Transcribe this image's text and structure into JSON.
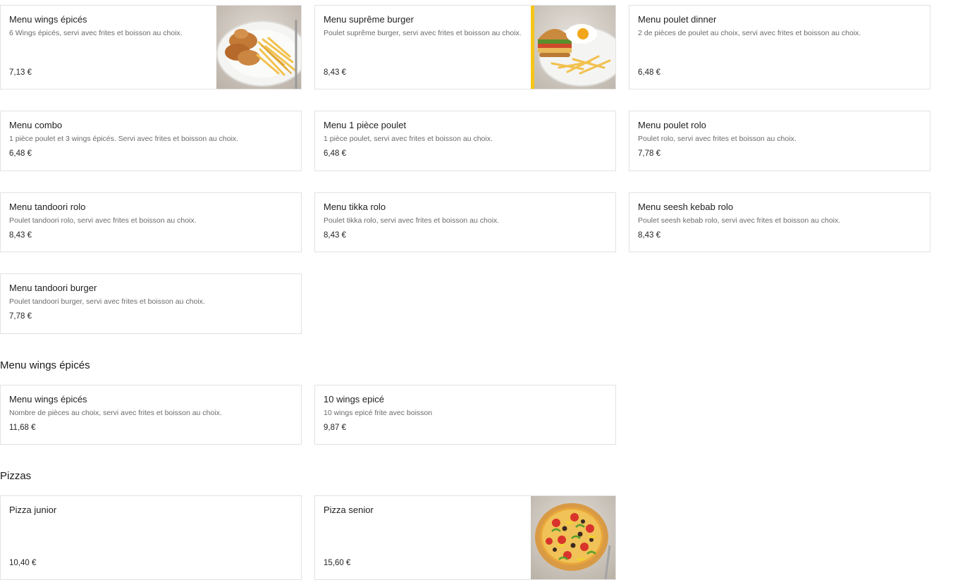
{
  "items": [
    {
      "title": "Menu wings épicés",
      "desc": "6 Wings épicés, servi avec frites et boisson au choix.",
      "price": "7,13 €",
      "image": "spicy-wings-fries-photo"
    },
    {
      "title": "Menu suprême burger",
      "desc": "Poulet suprême burger, servi avec frites et boisson au choix.",
      "price": "8,43 €",
      "image": "burger-fries-egg-photo"
    },
    {
      "title": "Menu poulet dinner",
      "desc": "2 de pièces de poulet au choix, servi avec frites et boisson au choix.",
      "price": "6,48 €"
    },
    {
      "title": "Menu combo",
      "desc": "1 pièce poulet et 3 wings épicés. Servi avec frites et boisson au choix.",
      "price": "6,48 €"
    },
    {
      "title": "Menu 1 pièce poulet",
      "desc": "1 pièce poulet, servi avec frites et boisson au choix.",
      "price": "6,48 €"
    },
    {
      "title": "Menu poulet rolo",
      "desc": "Poulet rolo, servi avec frites et boisson au choix.",
      "price": "7,78 €"
    },
    {
      "title": "Menu tandoori rolo",
      "desc": "Poulet tandoori rolo, servi avec frites et boisson au choix.",
      "price": "8,43 €"
    },
    {
      "title": "Menu tikka rolo",
      "desc": "Poulet tikka rolo, servi avec frites et boisson au choix.",
      "price": "8,43 €"
    },
    {
      "title": "Menu seesh kebab rolo",
      "desc": "Poulet seesh kebab rolo, servi avec frites et boisson au choix.",
      "price": "8,43 €"
    },
    {
      "title": "Menu tandoori burger",
      "desc": "Poulet tandoori burger, servi avec frites et boisson au choix.",
      "price": "7,78 €"
    }
  ],
  "section_wings": {
    "title": "Menu wings épicés",
    "items": [
      {
        "title": "Menu wings épicés",
        "desc": "Nombre de pièces au choix, servi avec frites et boisson au choix.",
        "price": "11,68 €"
      },
      {
        "title": "10 wings epicé",
        "desc": "10 wings epicé frite avec boisson",
        "price": "9,87 €"
      }
    ]
  },
  "section_pizzas": {
    "title": "Pizzas",
    "items": [
      {
        "title": "Pizza junior",
        "price": "10,40 €"
      },
      {
        "title": "Pizza senior",
        "price": "15,60 €",
        "image": "pizza-photo"
      }
    ]
  },
  "colors": {
    "card_border": "#e2e2e2",
    "title_text": "#1f1f1f",
    "desc_text": "#6b6b6b",
    "accent_yellow": "#f5c518"
  }
}
